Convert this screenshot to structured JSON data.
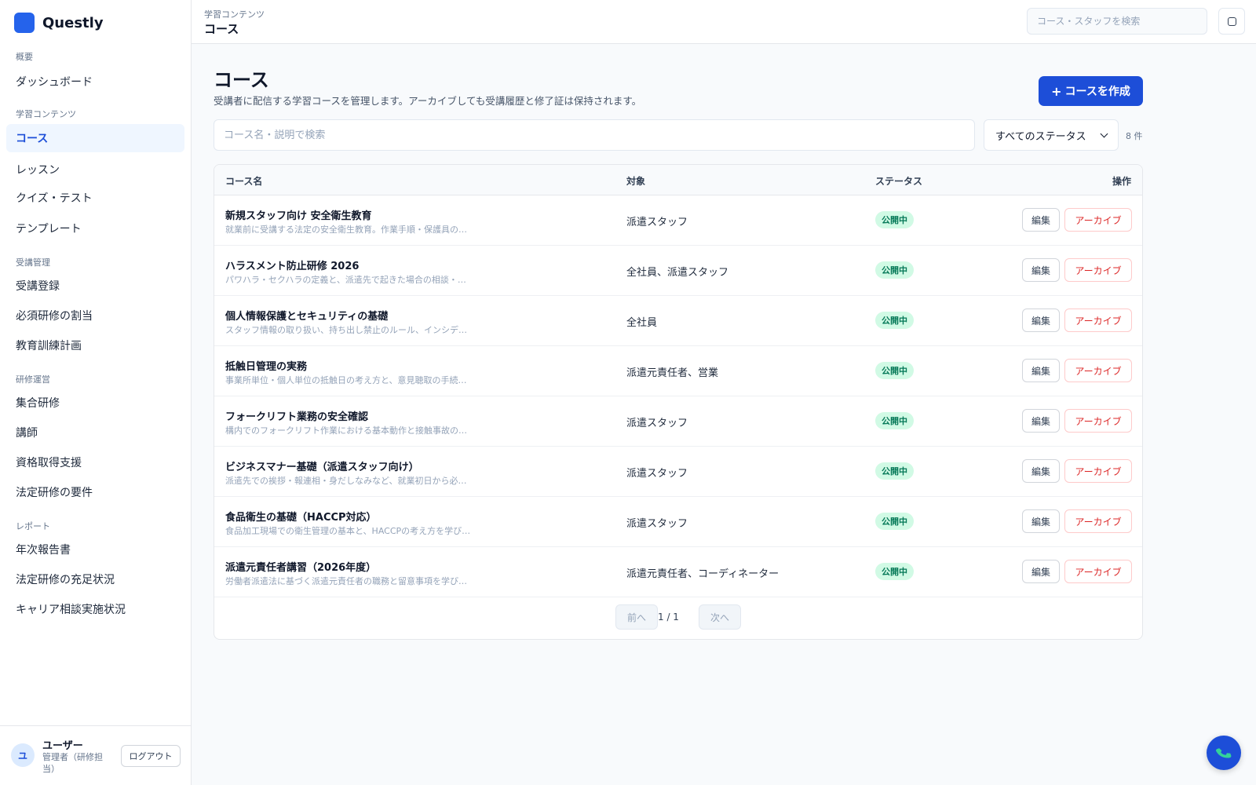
{
  "app": {
    "name": "Questly"
  },
  "sidebar": {
    "sections": [
      {
        "label": "概要",
        "items": [
          "ダッシュボード"
        ]
      },
      {
        "label": "学習コンテンツ",
        "items": [
          "コース",
          "レッスン",
          "クイズ・テスト",
          "テンプレート"
        ]
      },
      {
        "label": "受講管理",
        "items": [
          "受講登録",
          "必須研修の割当",
          "教育訓練計画"
        ]
      },
      {
        "label": "研修運営",
        "items": [
          "集合研修",
          "講師",
          "資格取得支援",
          "法定研修の要件"
        ]
      },
      {
        "label": "レポート",
        "items": [
          "年次報告書",
          "法定研修の充足状況",
          "キャリア相談実施状況"
        ]
      }
    ],
    "active_item": "コース"
  },
  "user": {
    "avatar": "ユ",
    "name": "ユーザー",
    "role": "管理者（研修担当）",
    "logout": "ログアウト"
  },
  "header": {
    "breadcrumb": "学習コンテンツ",
    "title": "コース",
    "search_placeholder": "コース・スタッフを検索"
  },
  "page": {
    "title": "コース",
    "description": "受講者に配信する学習コースを管理します。アーカイブしても受講履歴と修了証は保持されます。",
    "create_button": "コースを作成",
    "search_placeholder": "コース名・説明で検索",
    "status_filter": "すべてのステータス",
    "count": "8 件"
  },
  "table": {
    "columns": [
      "コース名",
      "対象",
      "ステータス",
      "操作"
    ],
    "rows": [
      {
        "title": "新規スタッフ向け 安全衛生教育",
        "desc": "就業前に受講する法定の安全衛生教育。作業手順・保護具の…",
        "target": "派遣スタッフ",
        "status": "公開中",
        "edit": "編集",
        "archive": "アーカイブ"
      },
      {
        "title": "ハラスメント防止研修 2026",
        "desc": "パワハラ・セクハラの定義と、派遣先で起きた場合の相談・…",
        "target": "全社員、派遣スタッフ",
        "status": "公開中",
        "edit": "編集",
        "archive": "アーカイブ"
      },
      {
        "title": "個人情報保護とセキュリティの基礎",
        "desc": "スタッフ情報の取り扱い、持ち出し禁止のルール、インシデ…",
        "target": "全社員",
        "status": "公開中",
        "edit": "編集",
        "archive": "アーカイブ"
      },
      {
        "title": "抵触日管理の実務",
        "desc": "事業所単位・個人単位の抵触日の考え方と、意見聴取の手続…",
        "target": "派遣元責任者、営業",
        "status": "公開中",
        "edit": "編集",
        "archive": "アーカイブ"
      },
      {
        "title": "フォークリフト業務の安全確認",
        "desc": "構内でのフォークリフト作業における基本動作と接触事故の…",
        "target": "派遣スタッフ",
        "status": "公開中",
        "edit": "編集",
        "archive": "アーカイブ"
      },
      {
        "title": "ビジネスマナー基礎（派遣スタッフ向け）",
        "desc": "派遣先での挨拶・報連相・身だしなみなど、就業初日から必…",
        "target": "派遣スタッフ",
        "status": "公開中",
        "edit": "編集",
        "archive": "アーカイブ"
      },
      {
        "title": "食品衛生の基礎（HACCP対応）",
        "desc": "食品加工現場での衛生管理の基本と、HACCPの考え方を学び…",
        "target": "派遣スタッフ",
        "status": "公開中",
        "edit": "編集",
        "archive": "アーカイブ"
      },
      {
        "title": "派遣元責任者講習（2026年度）",
        "desc": "労働者派遣法に基づく派遣元責任者の職務と留意事項を学び…",
        "target": "派遣元責任者、コーディネーター",
        "status": "公開中",
        "edit": "編集",
        "archive": "アーカイブ"
      }
    ]
  },
  "pagination": {
    "prev": "前へ",
    "page": "1 / 1",
    "next": "次へ"
  },
  "colors": {
    "accent": "#1d4ed8",
    "danger": "#dc2626",
    "success_bg": "#d1fae5",
    "success_text": "#047857"
  },
  "icons": {
    "top_button": "square-icon",
    "fab": "phone-icon"
  }
}
